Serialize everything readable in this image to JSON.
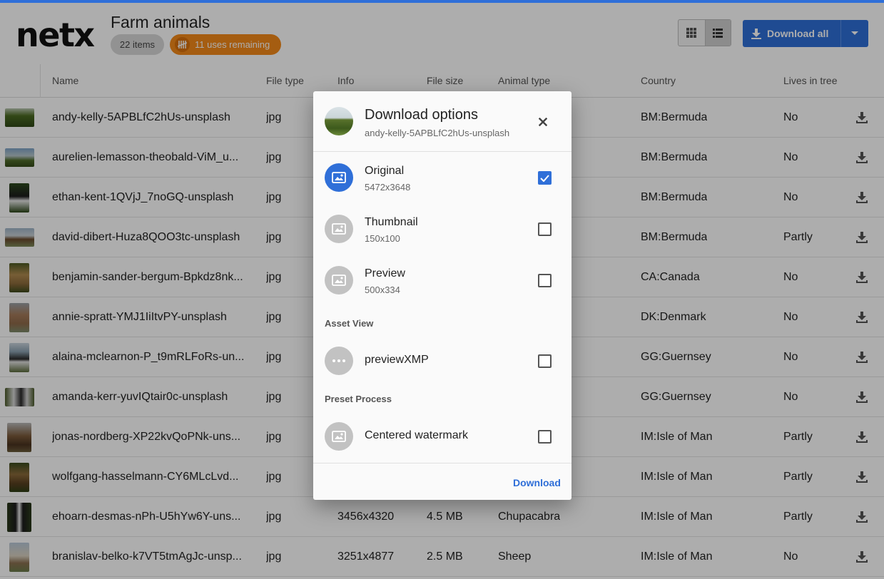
{
  "header": {
    "logo": "netx",
    "title": "Farm animals",
    "items_count": "22 items",
    "uses_remaining": "11 uses remaining",
    "download_all_label": "Download all",
    "view_mode": "list"
  },
  "table": {
    "columns": [
      "Name",
      "File type",
      "Info",
      "File size",
      "Animal type",
      "Country",
      "Lives in tree"
    ],
    "rows": [
      {
        "name": "andy-kelly-5APBLfC2hUs-unsplash",
        "type": "jpg",
        "info": "",
        "size": "",
        "animal": "",
        "country": "BM:Bermuda",
        "tree": "No"
      },
      {
        "name": "aurelien-lemasson-theobald-ViM_u...",
        "type": "jpg",
        "info": "",
        "size": "",
        "animal": "",
        "country": "BM:Bermuda",
        "tree": "No"
      },
      {
        "name": "ethan-kent-1QVjJ_7noGQ-unsplash",
        "type": "jpg",
        "info": "",
        "size": "",
        "animal": "",
        "country": "BM:Bermuda",
        "tree": "No"
      },
      {
        "name": "david-dibert-Huza8QOO3tc-unsplash",
        "type": "jpg",
        "info": "",
        "size": "",
        "animal": "",
        "country": "BM:Bermuda",
        "tree": "Partly"
      },
      {
        "name": "benjamin-sander-bergum-Bpkdz8nk...",
        "type": "jpg",
        "info": "",
        "size": "",
        "animal": "",
        "country": "CA:Canada",
        "tree": "No"
      },
      {
        "name": "annie-spratt-YMJ1IiItvPY-unsplash",
        "type": "jpg",
        "info": "",
        "size": "",
        "animal": "",
        "country": "DK:Denmark",
        "tree": "No"
      },
      {
        "name": "alaina-mclearnon-P_t9mRLFoRs-un...",
        "type": "jpg",
        "info": "",
        "size": "",
        "animal": "",
        "country": "GG:Guernsey",
        "tree": "No"
      },
      {
        "name": "amanda-kerr-yuvIQtair0c-unsplash",
        "type": "jpg",
        "info": "",
        "size": "",
        "animal": "",
        "country": "GG:Guernsey",
        "tree": "No"
      },
      {
        "name": "jonas-nordberg-XP22kvQoPNk-uns...",
        "type": "jpg",
        "info": "",
        "size": "",
        "animal": "",
        "country": "IM:Isle of Man",
        "tree": "Partly"
      },
      {
        "name": "wolfgang-hasselmann-CY6MLcLvd...",
        "type": "jpg",
        "info": "",
        "size": "",
        "animal": "",
        "country": "IM:Isle of Man",
        "tree": "Partly"
      },
      {
        "name": "ehoarn-desmas-nPh-U5hYw6Y-uns...",
        "type": "jpg",
        "info": "3456x4320",
        "size": "4.5 MB",
        "animal": "Chupacabra",
        "country": "IM:Isle of Man",
        "tree": "Partly"
      },
      {
        "name": "branislav-belko-k7VT5tmAgJc-unsp...",
        "type": "jpg",
        "info": "3251x4877",
        "size": "2.5 MB",
        "animal": "Sheep",
        "country": "IM:Isle of Man",
        "tree": "No"
      }
    ]
  },
  "modal": {
    "title": "Download options",
    "subtitle": "andy-kelly-5APBLfC2hUs-unsplash",
    "options": [
      {
        "label": "Original",
        "size": "5472x3648",
        "checked": true
      },
      {
        "label": "Thumbnail",
        "size": "150x100",
        "checked": false
      },
      {
        "label": "Preview",
        "size": "500x334",
        "checked": false
      }
    ],
    "asset_view_heading": "Asset View",
    "asset_view_options": [
      {
        "label": "previewXMP",
        "checked": false
      }
    ],
    "preset_heading": "Preset Process",
    "preset_options": [
      {
        "label": "Centered watermark",
        "checked": false
      }
    ],
    "download_label": "Download"
  },
  "colors": {
    "accent": "#2f6fd8",
    "uses_badge": "#f38a1a",
    "items_badge": "#d8d8d8"
  },
  "icons": [
    "grid-view-icon",
    "list-view-icon",
    "download-icon",
    "chevron-down-icon",
    "close-icon",
    "image-icon",
    "more-icon",
    "check-icon",
    "tally-icon"
  ]
}
